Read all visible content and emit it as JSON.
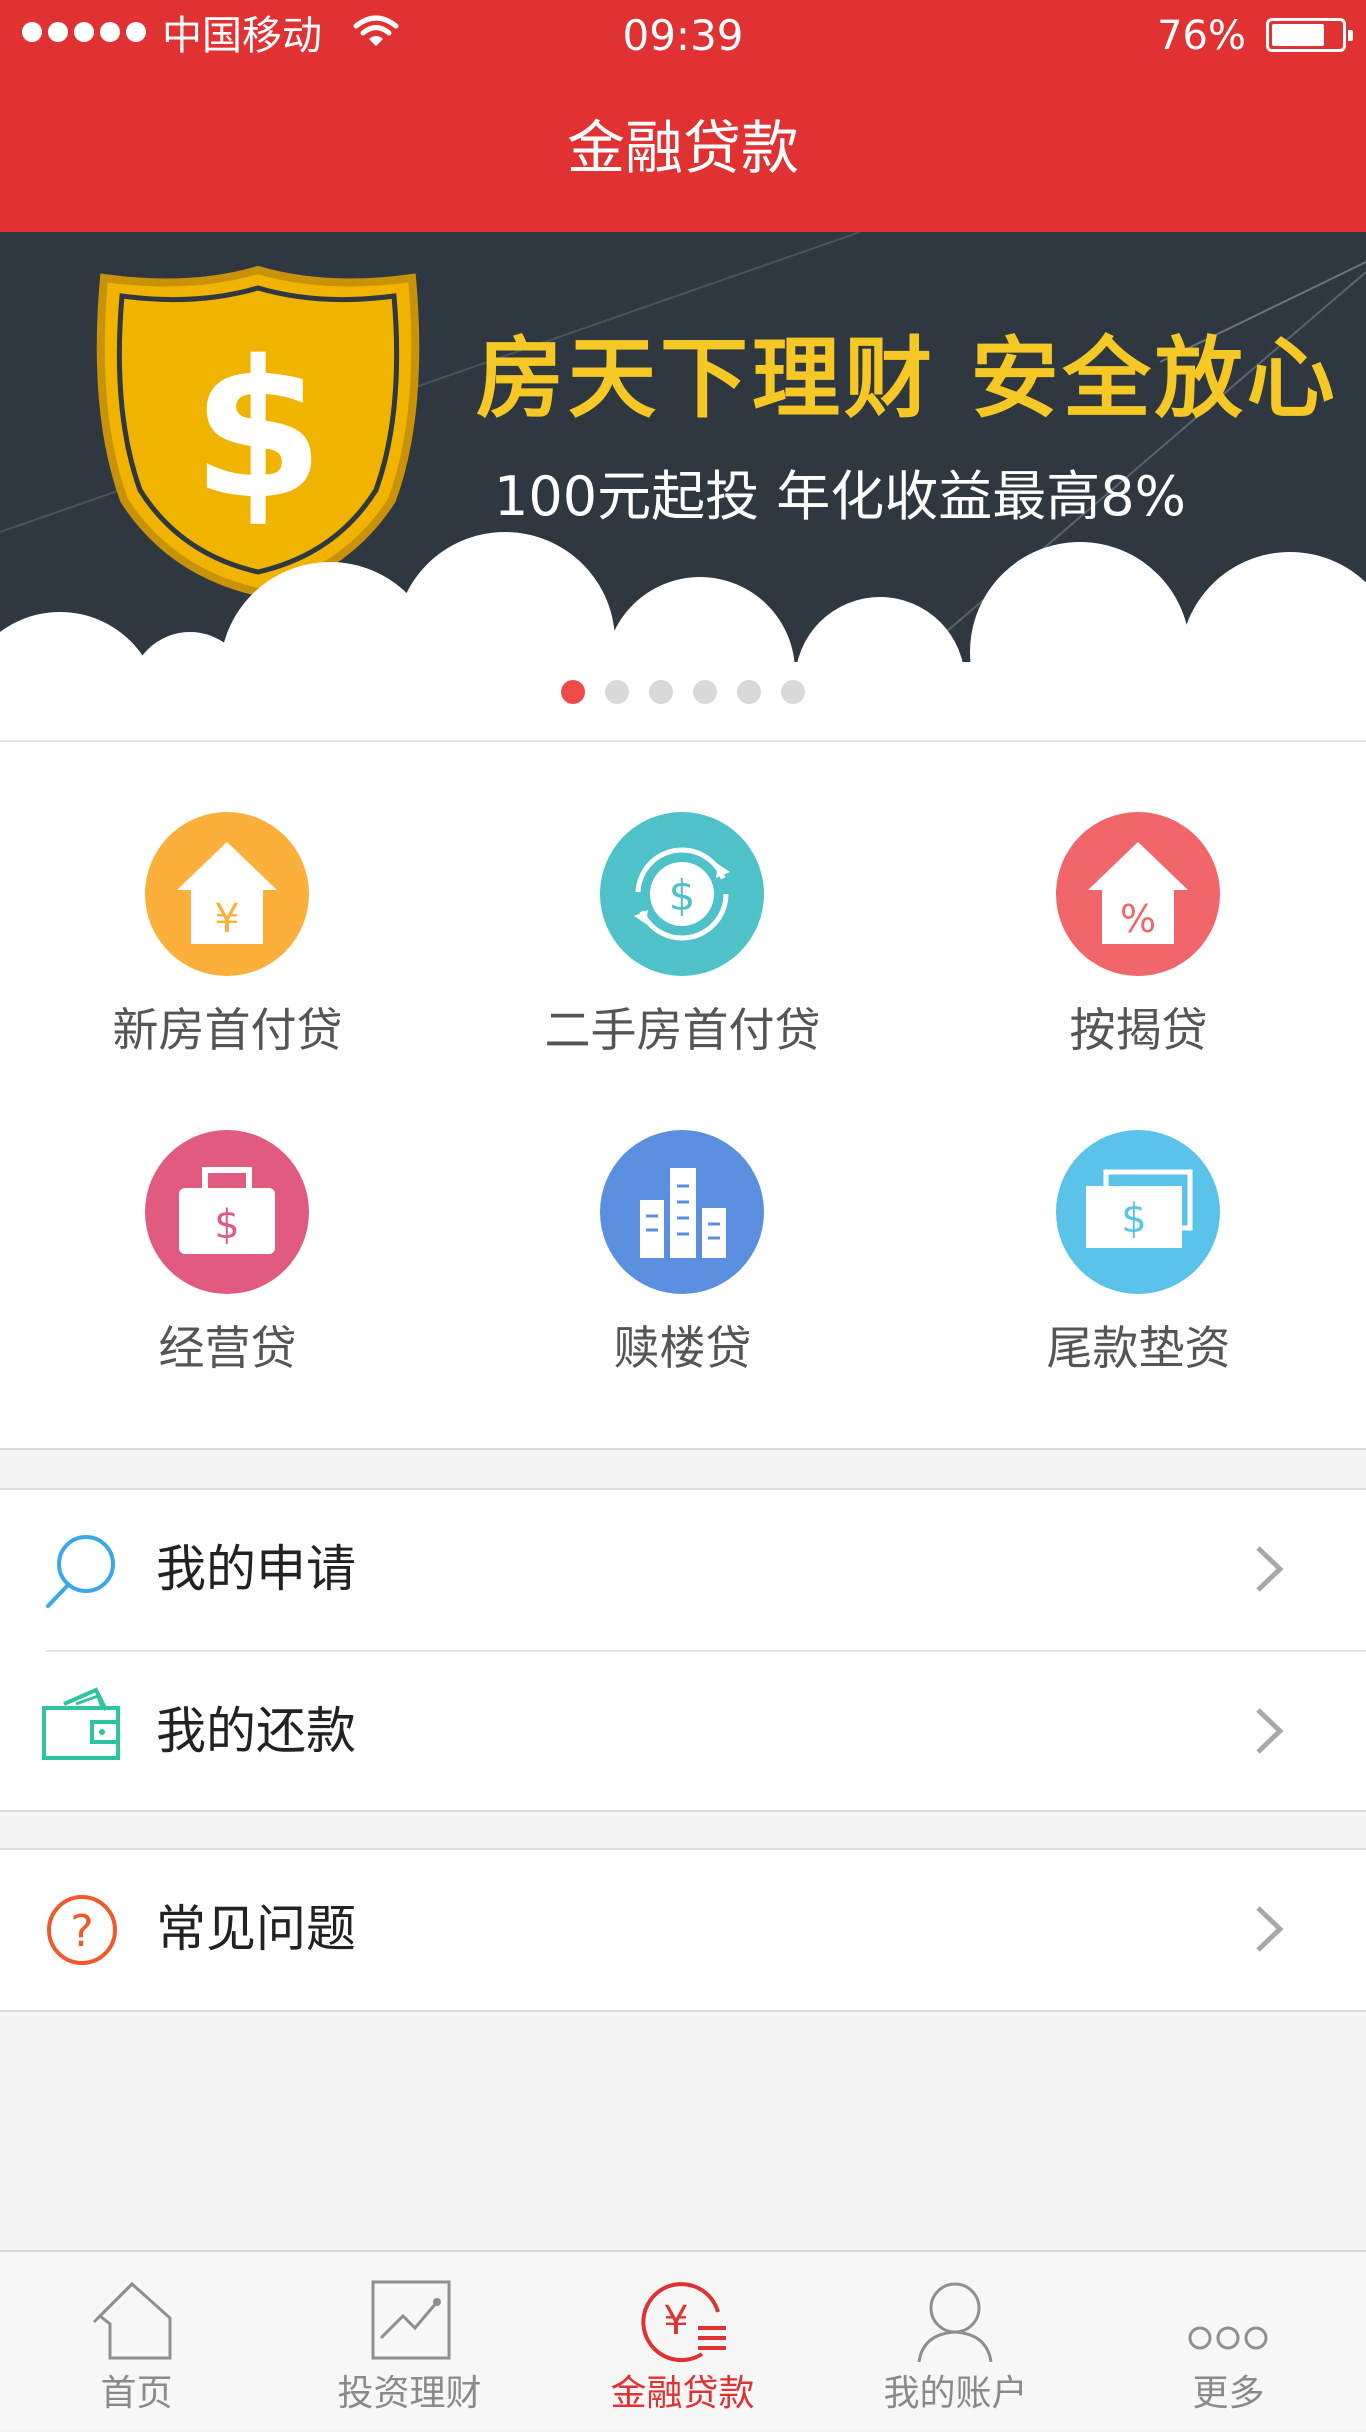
{
  "status_bar": {
    "carrier": "中国移动",
    "time": "09:39",
    "battery_percent": "76%",
    "battery_level": 0.76
  },
  "nav": {
    "title": "金融贷款"
  },
  "banner": {
    "title": "房天下理财  安全放心",
    "subtitle": "100元起投   年化收益最高8%",
    "page_count": 6,
    "active_page": 1
  },
  "services": [
    {
      "label": "新房首付贷",
      "icon": "house-yen-icon",
      "color": "#fbb03b"
    },
    {
      "label": "二手房首付贷",
      "icon": "dollar-cycle-icon",
      "color": "#4fc2c9"
    },
    {
      "label": "按揭贷",
      "icon": "house-percent-icon",
      "color": "#f0666b"
    },
    {
      "label": "经营贷",
      "icon": "briefcase-dollar-icon",
      "color": "#e15a80"
    },
    {
      "label": "赎楼贷",
      "icon": "buildings-icon",
      "color": "#5b8fe0"
    },
    {
      "label": "尾款垫资",
      "icon": "cash-stack-icon",
      "color": "#5bc3ea"
    }
  ],
  "menu": {
    "my_application": {
      "label": "我的申请",
      "icon": "search-icon"
    },
    "my_repayment": {
      "label": "我的还款",
      "icon": "wallet-icon"
    },
    "faq": {
      "label": "常见问题",
      "icon": "question-icon"
    }
  },
  "tabbar": {
    "home": {
      "label": "首页",
      "icon": "home-icon"
    },
    "invest": {
      "label": "投资理财",
      "icon": "chart-icon"
    },
    "loan": {
      "label": "金融贷款",
      "icon": "yen-list-icon",
      "active": true
    },
    "account": {
      "label": "我的账户",
      "icon": "user-icon"
    },
    "more": {
      "label": "更多",
      "icon": "more-icon"
    }
  },
  "colors": {
    "brand": "#e13233",
    "banner_bg": "#2f3841",
    "banner_title": "#f5c826"
  }
}
